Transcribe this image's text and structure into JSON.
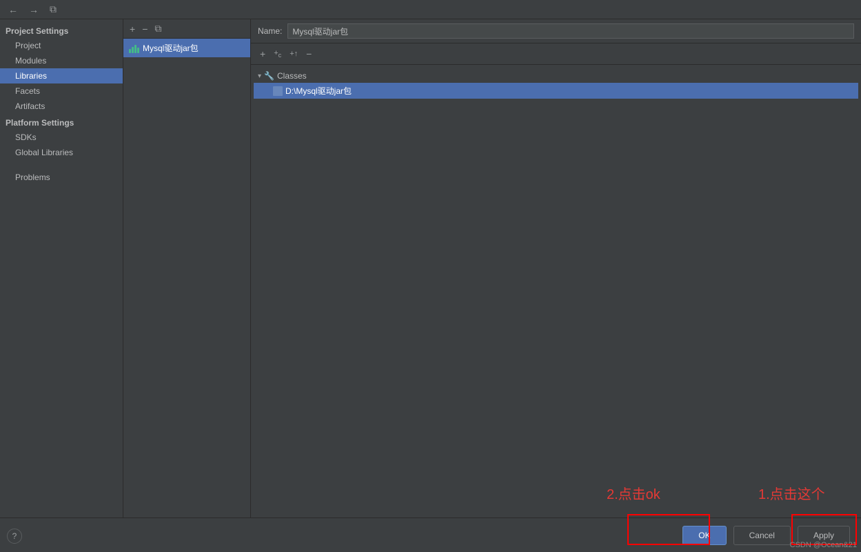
{
  "topBar": {
    "backBtn": "←",
    "forwardBtn": "→",
    "copyBtn": "⧉"
  },
  "sidebar": {
    "projectSettings": {
      "label": "Project Settings",
      "items": [
        {
          "id": "project",
          "label": "Project"
        },
        {
          "id": "modules",
          "label": "Modules"
        },
        {
          "id": "libraries",
          "label": "Libraries",
          "active": true
        },
        {
          "id": "facets",
          "label": "Facets"
        },
        {
          "id": "artifacts",
          "label": "Artifacts"
        }
      ]
    },
    "platformSettings": {
      "label": "Platform Settings",
      "items": [
        {
          "id": "sdks",
          "label": "SDKs"
        },
        {
          "id": "globalLibraries",
          "label": "Global Libraries"
        }
      ]
    },
    "problems": {
      "label": "Problems"
    }
  },
  "libraryPanel": {
    "toolbar": {
      "addBtn": "+",
      "removeBtn": "−",
      "copyBtn": "⧉"
    },
    "items": [
      {
        "id": "mysql-jar",
        "label": "Mysql驱动jar包",
        "selected": true
      }
    ]
  },
  "detailPanel": {
    "nameLabel": "Name:",
    "nameValue": "Mysql驱动jar包",
    "toolbar": {
      "addBtn": "+",
      "addClassesBtn": "+▾",
      "addJarBtn": "+⬆",
      "removeBtn": "−"
    },
    "tree": {
      "classesLabel": "Classes",
      "classesExpanded": true,
      "items": [
        {
          "id": "mysql-path",
          "label": "D:\\Mysql驱动jar包",
          "highlighted": true
        }
      ]
    }
  },
  "bottomBar": {
    "okLabel": "OK",
    "cancelLabel": "Cancel",
    "applyLabel": "Apply",
    "helpLabel": "?"
  },
  "annotations": {
    "text1": "1.点击这个",
    "text2": "2.点击ok"
  },
  "watermark": "CSDN @Ocean&21"
}
